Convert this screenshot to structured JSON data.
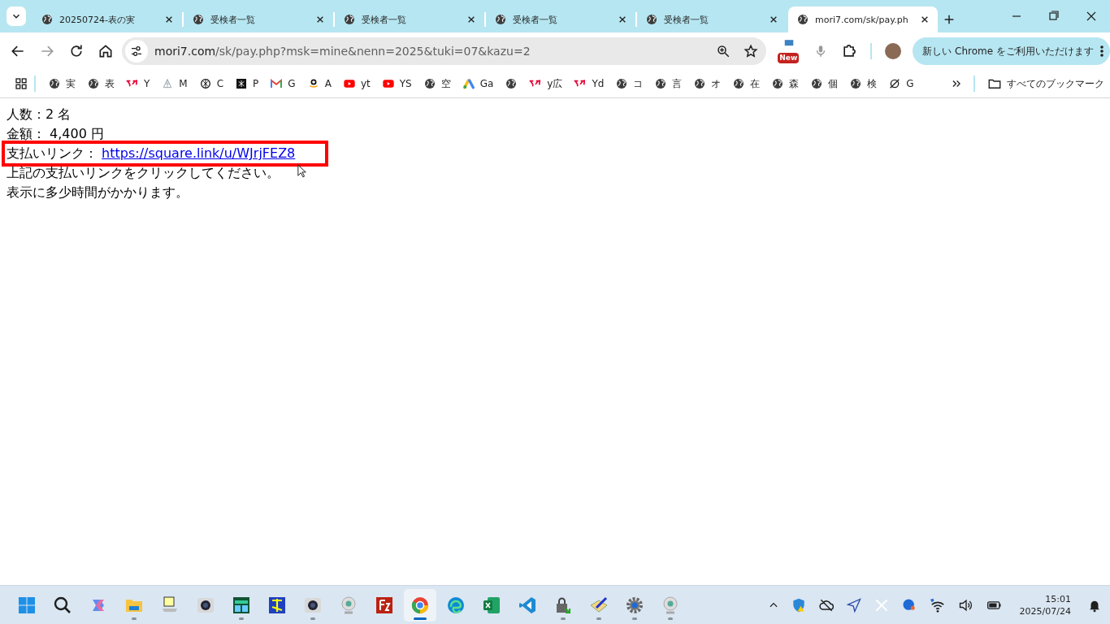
{
  "tabs": [
    {
      "title": "20250724-表の実",
      "selected": false
    },
    {
      "title": "受検者一覧",
      "selected": false
    },
    {
      "title": "受検者一覧",
      "selected": false
    },
    {
      "title": "受検者一覧",
      "selected": false
    },
    {
      "title": "受検者一覧",
      "selected": false
    },
    {
      "title": "mori7.com/sk/pay.ph",
      "selected": true
    }
  ],
  "address_bar": {
    "host": "mori7.com",
    "path": "/sk/pay.php?msk=mine&nenn=2025&tuki=07&kazu=2"
  },
  "toolbar": {
    "new_badge": "New",
    "update_button": "新しい Chrome をご利用いただけます"
  },
  "bookmarks": [
    {
      "kind": "globe",
      "label": "実"
    },
    {
      "kind": "globe",
      "label": "表"
    },
    {
      "kind": "yahoo",
      "label": "Y"
    },
    {
      "kind": "sail",
      "label": "M"
    },
    {
      "kind": "knot",
      "label": "C"
    },
    {
      "kind": "dark",
      "label": "P"
    },
    {
      "kind": "mail",
      "label": "G"
    },
    {
      "kind": "smile",
      "label": "A"
    },
    {
      "kind": "play",
      "label": "yt"
    },
    {
      "kind": "play",
      "label": "YS"
    },
    {
      "kind": "globe",
      "label": "空"
    },
    {
      "kind": "ads",
      "label": "Ga"
    },
    {
      "kind": "globe"
    },
    {
      "kind": "yahoo",
      "label": "y広"
    },
    {
      "kind": "yahoo",
      "label": "Yd"
    },
    {
      "kind": "globe",
      "label": "コ"
    },
    {
      "kind": "globe",
      "label": "言"
    },
    {
      "kind": "globe",
      "label": "オ"
    },
    {
      "kind": "globe",
      "label": "在"
    },
    {
      "kind": "globe",
      "label": "森"
    },
    {
      "kind": "globe",
      "label": "個"
    },
    {
      "kind": "globe",
      "label": "検"
    },
    {
      "kind": "slash",
      "label": "G"
    }
  ],
  "all_bookmarks": "すべてのブックマーク",
  "page": {
    "lines": [
      {
        "kind": "text",
        "text": "人数：2 名"
      },
      {
        "kind": "text",
        "text": "金額： 4,400 円"
      },
      {
        "kind": "link",
        "label": "支払いリンク：",
        "link": "https://square.link/u/WJrjFEZ8",
        "highlighted": true
      },
      {
        "kind": "text",
        "text": "上記の支払いリンクをクリックしてください。"
      },
      {
        "kind": "text",
        "text": "表示に多少時間がかかります。"
      }
    ]
  },
  "taskbar": {
    "apps": [
      {
        "kind": "windows",
        "running": false,
        "selected": false
      },
      {
        "kind": "search",
        "running": false,
        "selected": false
      },
      {
        "kind": "copilot",
        "running": false,
        "selected": false
      },
      {
        "kind": "folder",
        "running": true,
        "selected": false
      },
      {
        "kind": "tapp",
        "running": false,
        "selected": false
      },
      {
        "kind": "camera",
        "running": false,
        "selected": false
      },
      {
        "kind": "greenapp",
        "running": true,
        "selected": false
      },
      {
        "kind": "blueapp",
        "running": false,
        "selected": false
      },
      {
        "kind": "camera",
        "running": true,
        "selected": false
      },
      {
        "kind": "webcam",
        "running": false,
        "selected": false
      },
      {
        "kind": "ftp",
        "running": false,
        "selected": false
      },
      {
        "kind": "chrome",
        "running": true,
        "selected": true
      },
      {
        "kind": "edge",
        "running": false,
        "selected": false
      },
      {
        "kind": "excel",
        "running": false,
        "selected": false
      },
      {
        "kind": "code",
        "running": false,
        "selected": false
      },
      {
        "kind": "lock",
        "running": true,
        "selected": false
      },
      {
        "kind": "pen",
        "running": true,
        "selected": false
      },
      {
        "kind": "gear",
        "running": true,
        "selected": false
      },
      {
        "kind": "webcam",
        "running": true,
        "selected": false
      }
    ],
    "time": "15:01",
    "date": "2025/07/24"
  }
}
